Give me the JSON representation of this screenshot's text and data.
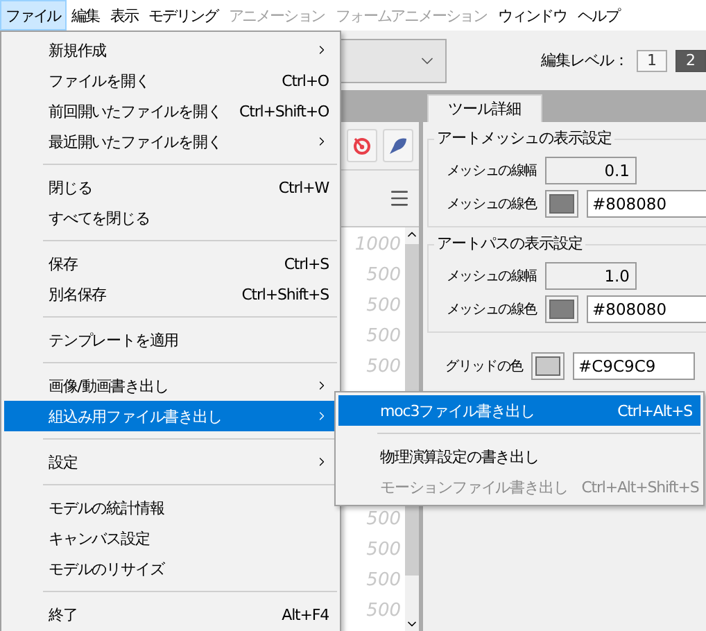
{
  "menubar": [
    {
      "label": "ファイル",
      "selected": true,
      "disabled": false
    },
    {
      "label": "編集",
      "selected": false,
      "disabled": false
    },
    {
      "label": "表示",
      "selected": false,
      "disabled": false
    },
    {
      "label": "モデリング",
      "selected": false,
      "disabled": false
    },
    {
      "label": "アニメーション",
      "selected": false,
      "disabled": true
    },
    {
      "label": "フォームアニメーション",
      "selected": false,
      "disabled": true
    },
    {
      "label": "ウィンドウ",
      "selected": false,
      "disabled": false
    },
    {
      "label": "ヘルプ",
      "selected": false,
      "disabled": false
    }
  ],
  "toolbar": {
    "edit_level_label": "編集レベル：",
    "levels": [
      {
        "label": "1",
        "selected": false
      },
      {
        "label": "2",
        "selected": true
      }
    ]
  },
  "list_panel": {
    "values": [
      "1000",
      "500",
      "500",
      "500",
      "500",
      "500",
      "500",
      "500",
      "500"
    ]
  },
  "tool_panel": {
    "tab": "ツール詳細",
    "groups": [
      {
        "title": "アートメッシュの表示設定",
        "width_label": "メッシュの線幅",
        "width_value": "0.1",
        "color_label": "メッシュの線色",
        "color": "#808080",
        "color_value": "#808080"
      },
      {
        "title": "アートパスの表示設定",
        "width_label": "メッシュの線幅",
        "width_value": "1.0",
        "color_label": "メッシュの線色",
        "color": "#808080",
        "color_value": "#808080"
      }
    ],
    "grid": {
      "label": "グリッドの色",
      "color": "#c9c9c9",
      "value": "#C9C9C9"
    }
  },
  "file_menu": [
    {
      "kind": "item",
      "label": "新規作成",
      "submenu": true,
      "selected": false
    },
    {
      "kind": "item",
      "label": "ファイルを開く",
      "shortcut": "Ctrl+O",
      "selected": false
    },
    {
      "kind": "item",
      "label": "前回開いたファイルを開く",
      "shortcut": "Ctrl+Shift+O",
      "selected": false
    },
    {
      "kind": "item",
      "label": "最近開いたファイルを開く",
      "submenu": true,
      "selected": false
    },
    {
      "kind": "separator"
    },
    {
      "kind": "item",
      "label": "閉じる",
      "shortcut": "Ctrl+W",
      "selected": false
    },
    {
      "kind": "item",
      "label": "すべてを閉じる",
      "selected": false
    },
    {
      "kind": "separator"
    },
    {
      "kind": "item",
      "label": "保存",
      "shortcut": "Ctrl+S",
      "selected": false
    },
    {
      "kind": "item",
      "label": "別名保存",
      "shortcut": "Ctrl+Shift+S",
      "selected": false
    },
    {
      "kind": "separator"
    },
    {
      "kind": "item",
      "label": "テンプレートを適用",
      "selected": false
    },
    {
      "kind": "separator"
    },
    {
      "kind": "item",
      "label": "画像/動画書き出し",
      "submenu": true,
      "selected": false
    },
    {
      "kind": "item",
      "label": "組込み用ファイル書き出し",
      "submenu": true,
      "selected": true
    },
    {
      "kind": "separator"
    },
    {
      "kind": "item",
      "label": "設定",
      "submenu": true,
      "selected": false
    },
    {
      "kind": "separator"
    },
    {
      "kind": "item",
      "label": "モデルの統計情報",
      "selected": false
    },
    {
      "kind": "item",
      "label": "キャンバス設定",
      "selected": false
    },
    {
      "kind": "item",
      "label": "モデルのリサイズ",
      "selected": false
    },
    {
      "kind": "separator"
    },
    {
      "kind": "item",
      "label": "終了",
      "shortcut": "Alt+F4",
      "selected": false
    }
  ],
  "export_submenu": [
    {
      "kind": "item",
      "label": "moc3ファイル書き出し",
      "shortcut": "Ctrl+Alt+S",
      "selected": true,
      "disabled": false
    },
    {
      "kind": "separator"
    },
    {
      "kind": "item",
      "label": "物理演算設定の書き出し",
      "selected": false,
      "disabled": false
    },
    {
      "kind": "item",
      "label": "モーションファイル書き出し",
      "shortcut": "Ctrl+Alt+Shift+S",
      "selected": false,
      "disabled": true
    }
  ]
}
